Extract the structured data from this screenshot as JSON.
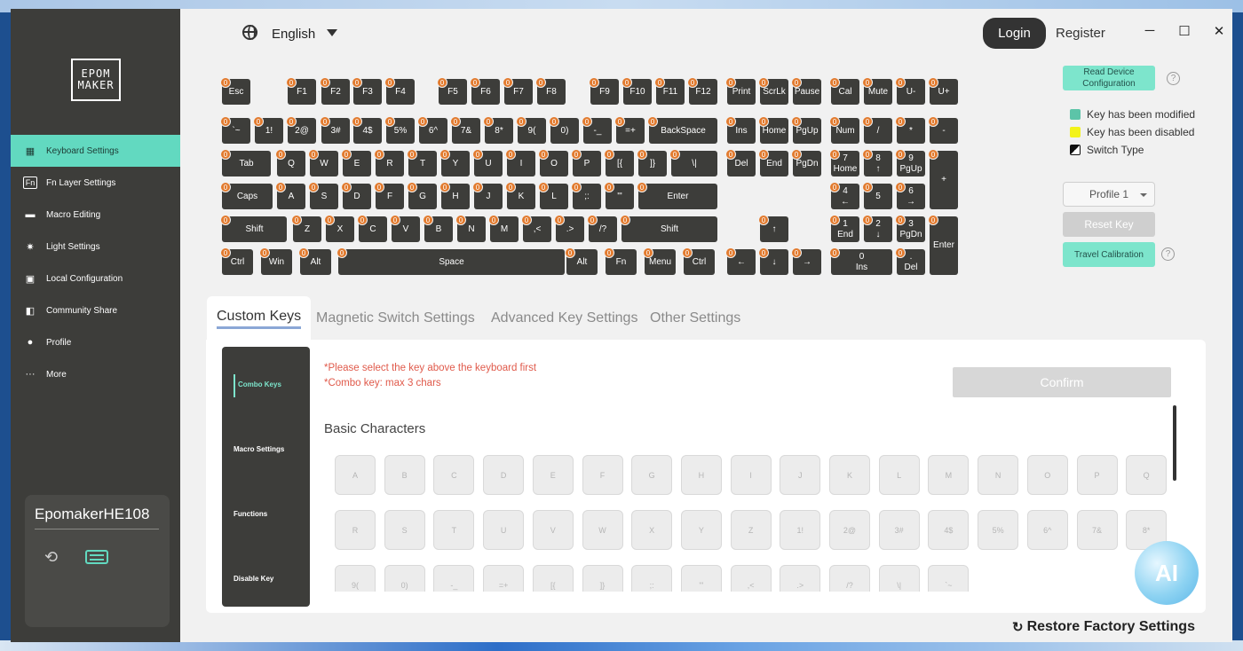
{
  "app": {
    "logo_text": "EPOM\nMAKER"
  },
  "topbar": {
    "language": "English",
    "login_label": "Login",
    "register_label": "Register",
    "minimize": "─",
    "maximize": "☐",
    "close": "✕"
  },
  "sidebar": {
    "items": [
      {
        "label": "Keyboard Settings",
        "icon": "keyboard-icon",
        "glyph": "▦"
      },
      {
        "label": "Fn Layer Settings",
        "icon": "fn-icon",
        "glyph": "Fn"
      },
      {
        "label": "Macro Editing",
        "icon": "macro-icon",
        "glyph": "▬"
      },
      {
        "label": "Light Settings",
        "icon": "light-icon",
        "glyph": "✷"
      },
      {
        "label": "Local Configuration",
        "icon": "config-icon",
        "glyph": "▣"
      },
      {
        "label": "Community Share",
        "icon": "share-icon",
        "glyph": "◧"
      },
      {
        "label": "Profile",
        "icon": "profile-icon",
        "glyph": "●"
      },
      {
        "label": "More",
        "icon": "more-icon",
        "glyph": "···"
      }
    ],
    "active_index": 0,
    "device_name": "EpomakerHE108"
  },
  "keyboard": {
    "badge": "0",
    "keys": [
      "Esc",
      "F1",
      "F2",
      "F3",
      "F4",
      "F5",
      "F6",
      "F7",
      "F8",
      "F9",
      "F10",
      "F11",
      "F12",
      "Print",
      "ScrLk",
      "Pause",
      "Cal",
      "Mute",
      "U-",
      "U+",
      "`~",
      "1!",
      "2@",
      "3#",
      "4$",
      "5%",
      "6^",
      "7&",
      "8*",
      "9(",
      "0)",
      "-_",
      "=+",
      "BackSpace",
      "Ins",
      "Home",
      "PgUp",
      "Num",
      "/",
      "*",
      "-",
      "Tab",
      "Q",
      "W",
      "E",
      "R",
      "T",
      "Y",
      "U",
      "I",
      "O",
      "P",
      "[{",
      "]}",
      "\\|",
      "Del",
      "End",
      "PgDn",
      "7\nHome",
      "8\n↑",
      "9\nPgUp",
      "+",
      "Caps",
      "A",
      "S",
      "D",
      "F",
      "G",
      "H",
      "J",
      "K",
      "L",
      ";:",
      "'\"",
      "Enter",
      "4\n←",
      "5",
      "6\n→",
      "Shift",
      "Z",
      "X",
      "C",
      "V",
      "B",
      "N",
      "M",
      ",<",
      ".>",
      "/?",
      "Shift",
      "↑",
      "1\nEnd",
      "2\n↓",
      "3\nPgDn",
      "Enter",
      "Ctrl",
      "Win",
      "Alt",
      "Space",
      "Alt",
      "Fn",
      "Menu",
      "Ctrl",
      "←",
      "↓",
      "→",
      "0\nIns",
      ".\nDel"
    ]
  },
  "right_panel": {
    "read_config": "Read Device Configuration",
    "legend": [
      {
        "label": "Key has been modified",
        "color": "#5cc4a8"
      },
      {
        "label": "Key has been disabled",
        "color": "#f3f31a"
      },
      {
        "label": "Switch Type",
        "color": "#111111"
      }
    ],
    "profile": "Profile 1",
    "reset_key": "Reset Key",
    "travel_calibration": "Travel Calibration"
  },
  "tabs": [
    "Custom Keys",
    "Magnetic Switch Settings",
    "Advanced Key Settings",
    "Other Settings"
  ],
  "custom_keys": {
    "sub_items": [
      "Combo Keys",
      "Macro Settings",
      "Functions",
      "Disable Key"
    ],
    "note1": "*Please select the key above the keyboard first",
    "note2": "*Combo key: max 3 chars",
    "confirm": "Confirm",
    "basic_title": "Basic Characters",
    "chars": [
      "A",
      "B",
      "C",
      "D",
      "E",
      "F",
      "G",
      "H",
      "I",
      "J",
      "K",
      "L",
      "M",
      "N",
      "O",
      "P",
      "Q",
      "R",
      "S",
      "T",
      "U",
      "V",
      "W",
      "X",
      "Y",
      "Z",
      "1!",
      "2@",
      "3#",
      "4$",
      "5%",
      "6^",
      "7&",
      "8*",
      "9(",
      "0)",
      "-_",
      "=+",
      "[{",
      "]}",
      ";:",
      "'\"",
      ",<",
      ".>",
      "/?",
      "\\|",
      "`~"
    ]
  },
  "restore_label": "Restore Factory Settings",
  "ai_label": "AI"
}
